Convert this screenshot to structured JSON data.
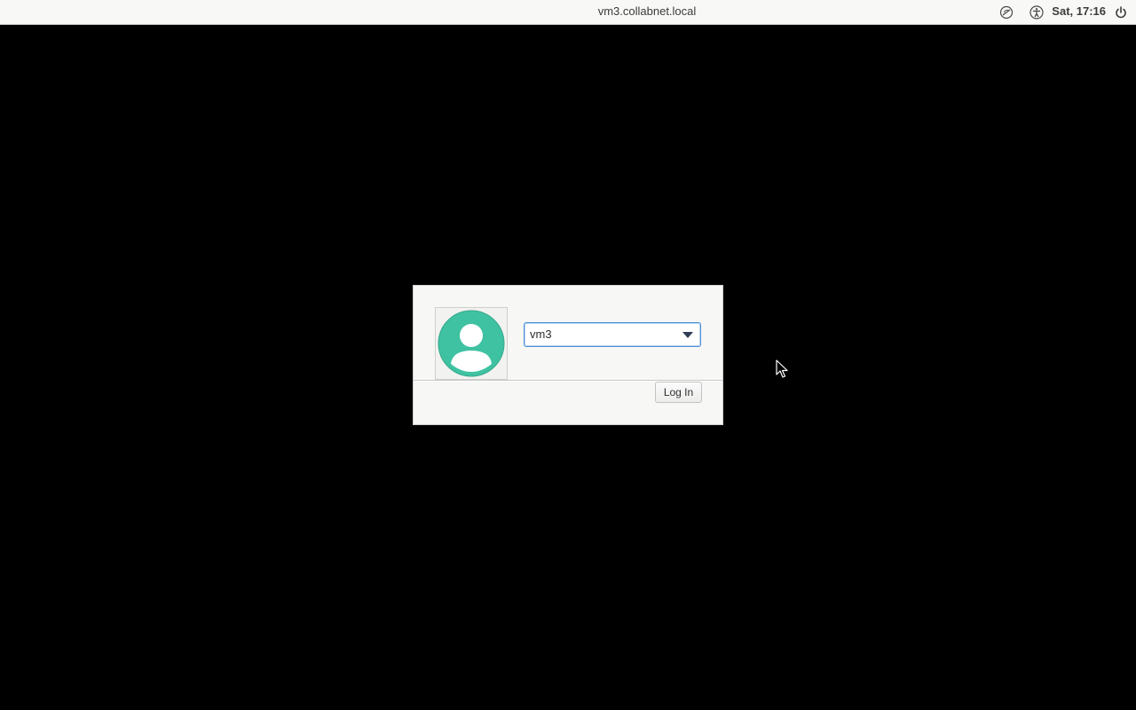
{
  "topbar": {
    "hostname": "vm3.collabnet.local",
    "clock": "Sat, 17:16",
    "icons": [
      "network-icon",
      "accessibility-icon",
      "power-icon"
    ]
  },
  "login": {
    "selected_user": "vm3",
    "login_button_label": "Log In",
    "avatar_color": "#3fc2a2",
    "focus_color": "#4a90d9"
  }
}
